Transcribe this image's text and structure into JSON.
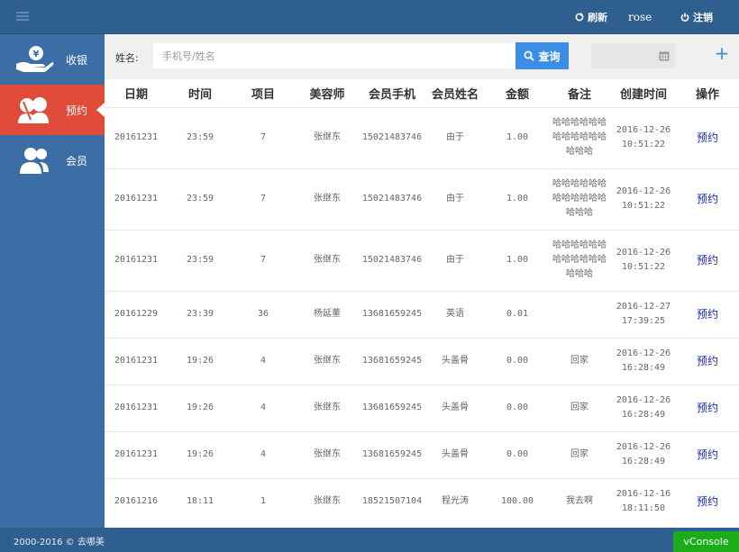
{
  "header": {
    "refresh_label": "刷新",
    "username": "rose",
    "logout_label": "注销"
  },
  "sidebar": {
    "items": [
      {
        "label": "收银",
        "icon": "cash-hand-icon"
      },
      {
        "label": "预约",
        "icon": "appointment-users-icon",
        "active": true
      },
      {
        "label": "会员",
        "icon": "members-icon"
      }
    ]
  },
  "search": {
    "label": "姓名:",
    "placeholder": "手机号/姓名",
    "button_label": "查询"
  },
  "table": {
    "columns": [
      "日期",
      "时间",
      "项目",
      "美容师",
      "会员手机",
      "会员姓名",
      "金额",
      "备注",
      "创建时间",
      "操作"
    ],
    "rows": [
      {
        "date": "20161231",
        "time": "23:59",
        "item": "7",
        "staff": "张继东",
        "phone": "15021483746",
        "name": "由于",
        "amount": "1.00",
        "note": "哈哈哈哈哈哈哈哈哈哈哈哈哈哈哈",
        "created_date": "2016-12-26",
        "created_time": "10:51:22",
        "action": "预约"
      },
      {
        "date": "20161231",
        "time": "23:59",
        "item": "7",
        "staff": "张继东",
        "phone": "15021483746",
        "name": "由于",
        "amount": "1.00",
        "note": "哈哈哈哈哈哈哈哈哈哈哈哈哈哈哈",
        "created_date": "2016-12-26",
        "created_time": "10:51:22",
        "action": "预约"
      },
      {
        "date": "20161231",
        "time": "23:59",
        "item": "7",
        "staff": "张继东",
        "phone": "15021483746",
        "name": "由于",
        "amount": "1.00",
        "note": "哈哈哈哈哈哈哈哈哈哈哈哈哈哈哈",
        "created_date": "2016-12-26",
        "created_time": "10:51:22",
        "action": "预约"
      },
      {
        "date": "20161229",
        "time": "23:39",
        "item": "36",
        "staff": "杨延董",
        "phone": "13681659245",
        "name": "英语",
        "amount": "0.01",
        "note": "",
        "created_date": "2016-12-27",
        "created_time": "17:39:25",
        "action": "预约"
      },
      {
        "date": "20161231",
        "time": "19:26",
        "item": "4",
        "staff": "张继东",
        "phone": "13681659245",
        "name": "头盖骨",
        "amount": "0.00",
        "note": "回家",
        "created_date": "2016-12-26",
        "created_time": "16:28:49",
        "action": "预约"
      },
      {
        "date": "20161231",
        "time": "19:26",
        "item": "4",
        "staff": "张继东",
        "phone": "13681659245",
        "name": "头盖骨",
        "amount": "0.00",
        "note": "回家",
        "created_date": "2016-12-26",
        "created_time": "16:28:49",
        "action": "预约"
      },
      {
        "date": "20161231",
        "time": "19:26",
        "item": "4",
        "staff": "张继东",
        "phone": "13681659245",
        "name": "头盖骨",
        "amount": "0.00",
        "note": "回家",
        "created_date": "2016-12-26",
        "created_time": "16:28:49",
        "action": "预约"
      },
      {
        "date": "20161216",
        "time": "18:11",
        "item": "1",
        "staff": "张继东",
        "phone": "18521507104",
        "name": "程光涛",
        "amount": "100.00",
        "note": "我去啊",
        "created_date": "2016-12-16",
        "created_time": "18:11:50",
        "action": "预约"
      }
    ]
  },
  "footer": {
    "copyright": "2000-2016 © 去哪美"
  },
  "vconsole_label": "vConsole",
  "colors": {
    "topbar": "#2f5f8f",
    "sidebar": "#3a6ea5",
    "active": "#e04b3a",
    "search_button": "#3b8ee6",
    "action_link": "#1a2aa8",
    "vconsole": "#1aad19"
  }
}
